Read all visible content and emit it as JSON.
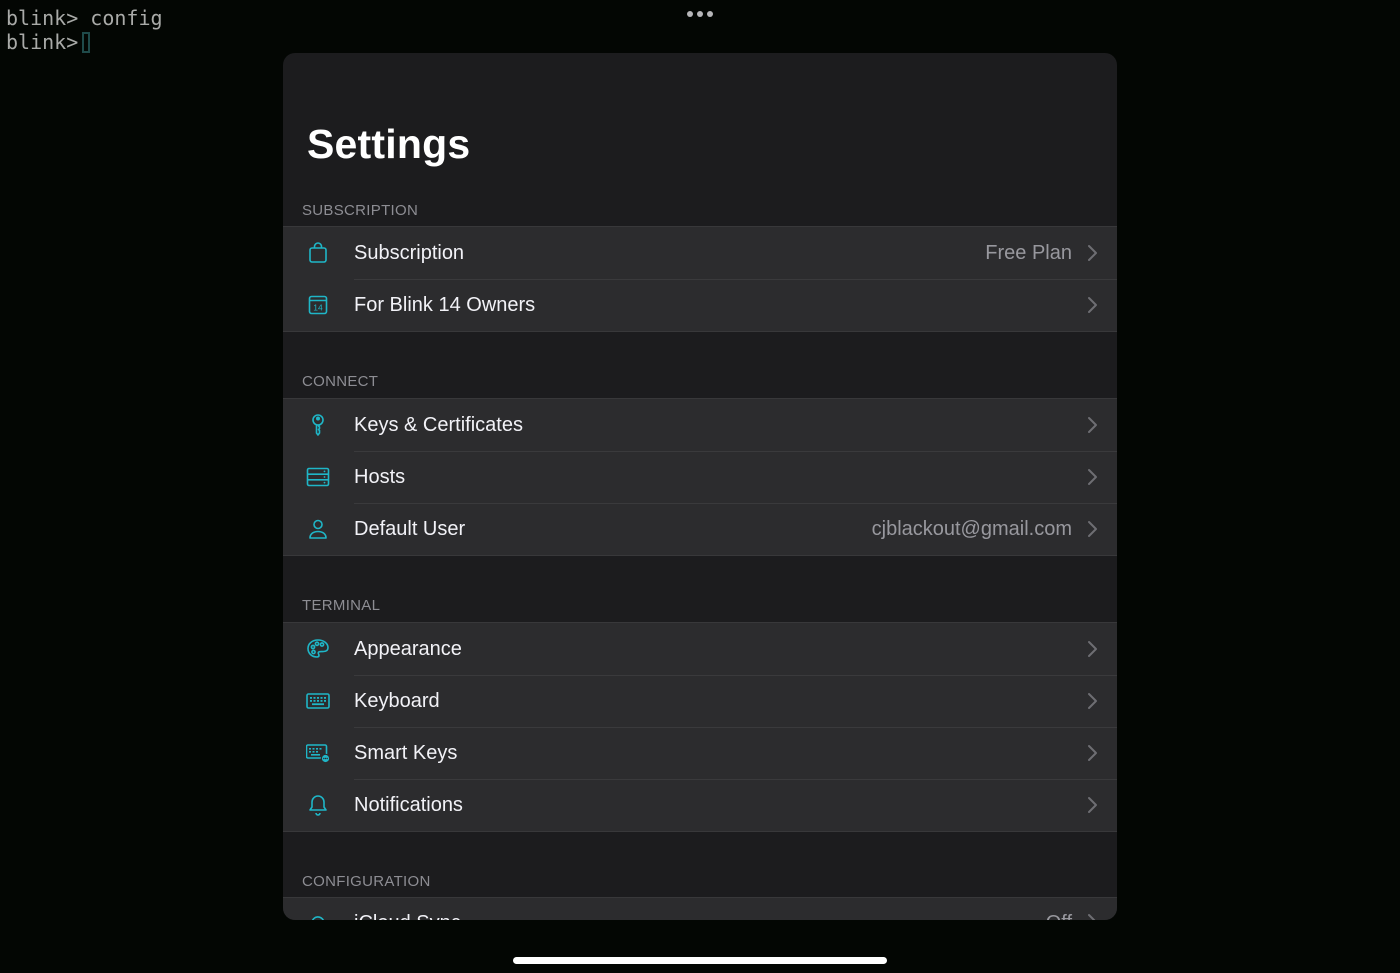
{
  "terminal": {
    "lines": [
      {
        "prompt": "blink>",
        "command": "config"
      },
      {
        "prompt": "blink>",
        "command": ""
      }
    ]
  },
  "settings": {
    "title": "Settings",
    "accent_color": "#1fb6c7",
    "sections": [
      {
        "header": "SUBSCRIPTION",
        "rows": [
          {
            "label": "Subscription",
            "value": "Free Plan",
            "icon": "bag-icon"
          },
          {
            "label": "For Blink 14 Owners",
            "value": "",
            "icon": "calendar-14-icon",
            "icon_text": "14"
          }
        ]
      },
      {
        "header": "CONNECT",
        "rows": [
          {
            "label": "Keys & Certificates",
            "value": "",
            "icon": "key-icon"
          },
          {
            "label": "Hosts",
            "value": "",
            "icon": "server-icon"
          },
          {
            "label": "Default User",
            "value": "cjblackout@gmail.com",
            "icon": "person-icon"
          }
        ]
      },
      {
        "header": "TERMINAL",
        "rows": [
          {
            "label": "Appearance",
            "value": "",
            "icon": "palette-icon"
          },
          {
            "label": "Keyboard",
            "value": "",
            "icon": "keyboard-icon"
          },
          {
            "label": "Smart Keys",
            "value": "",
            "icon": "smart-keyboard-icon"
          },
          {
            "label": "Notifications",
            "value": "",
            "icon": "bell-icon"
          }
        ]
      },
      {
        "header": "CONFIGURATION",
        "rows": [
          {
            "label": "iCloud Sync",
            "value": "Off",
            "icon": "cloud-icon"
          }
        ]
      }
    ]
  }
}
